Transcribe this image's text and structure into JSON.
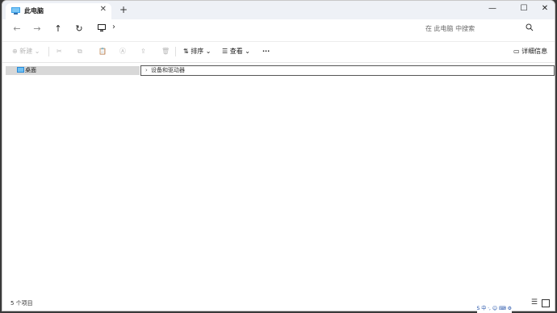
{
  "tab": {
    "title": "此电脑",
    "close": "✕",
    "new_tab": "+"
  },
  "window_controls": {
    "minimize": "—",
    "maximize": "☐",
    "close": "✕"
  },
  "nav": {
    "back": "←",
    "forward": "→",
    "up": "↑",
    "refresh": "↻",
    "breadcrumb_chevron": "›",
    "search_placeholder": "在 此电脑 中搜索"
  },
  "commands": {
    "new": "新建",
    "sort": "排序",
    "view": "查看",
    "more": "···",
    "details": "详细信息"
  },
  "sidebar": {
    "items": [
      {
        "label": "桌面",
        "icon": "desktop-icon",
        "selected": true
      }
    ]
  },
  "group": {
    "label": "设备和驱动器",
    "chevron": "›"
  },
  "status": {
    "item_count": "5 个项目"
  },
  "ime": {
    "text": "S 中 ·, ☺ ⌨ ⚙"
  },
  "colors": {
    "accent": "#0078d4",
    "titlebar": "#eef1f6",
    "selected": "#d8d8d8"
  }
}
